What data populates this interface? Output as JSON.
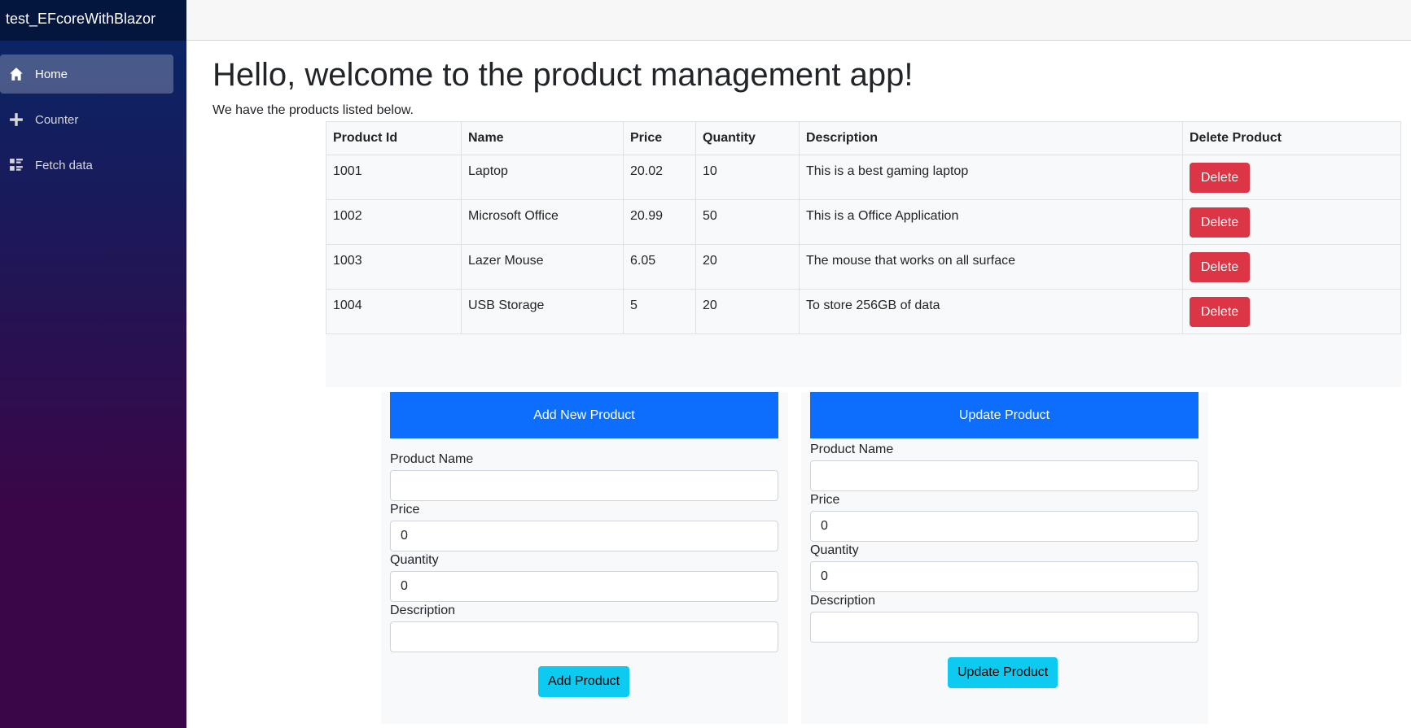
{
  "app": {
    "brand": "test_EFcoreWithBlazor"
  },
  "sidebar": {
    "items": [
      {
        "label": "Home",
        "icon": "home-icon",
        "active": true
      },
      {
        "label": "Counter",
        "icon": "plus-icon",
        "active": false
      },
      {
        "label": "Fetch data",
        "icon": "list-rich-icon",
        "active": false
      }
    ]
  },
  "main": {
    "heading": "Hello, welcome to the product management app!",
    "intro": "We have the products listed below."
  },
  "table": {
    "headers": [
      "Product Id",
      "Name",
      "Price",
      "Quantity",
      "Description",
      "Delete Product"
    ],
    "rows": [
      {
        "id": "1001",
        "name": "Laptop",
        "price": "20.02",
        "quantity": "10",
        "description": "This is a best gaming laptop",
        "action": "Delete"
      },
      {
        "id": "1002",
        "name": "Microsoft Office",
        "price": "20.99",
        "quantity": "50",
        "description": "This is a Office Application",
        "action": "Delete"
      },
      {
        "id": "1003",
        "name": "Lazer Mouse",
        "price": "6.05",
        "quantity": "20",
        "description": "The mouse that works on all surface",
        "action": "Delete"
      },
      {
        "id": "1004",
        "name": "USB Storage",
        "price": "5",
        "quantity": "20",
        "description": "To store 256GB of data",
        "action": "Delete"
      }
    ]
  },
  "add_form": {
    "title": "Add New Product",
    "name_label": "Product Name",
    "name_value": "",
    "price_label": "Price",
    "price_value": "0",
    "quantity_label": "Quantity",
    "quantity_value": "0",
    "description_label": "Description",
    "description_value": "",
    "submit": "Add Product"
  },
  "update_form": {
    "title": "Update Product",
    "name_label": "Product Name",
    "name_value": "",
    "price_label": "Price",
    "price_value": "0",
    "quantity_label": "Quantity",
    "quantity_value": "0",
    "description_label": "Description",
    "description_value": "",
    "submit": "Update Product"
  },
  "colors": {
    "primary": "#0d6efd",
    "danger": "#dc3545",
    "info": "#0dcaf0"
  }
}
